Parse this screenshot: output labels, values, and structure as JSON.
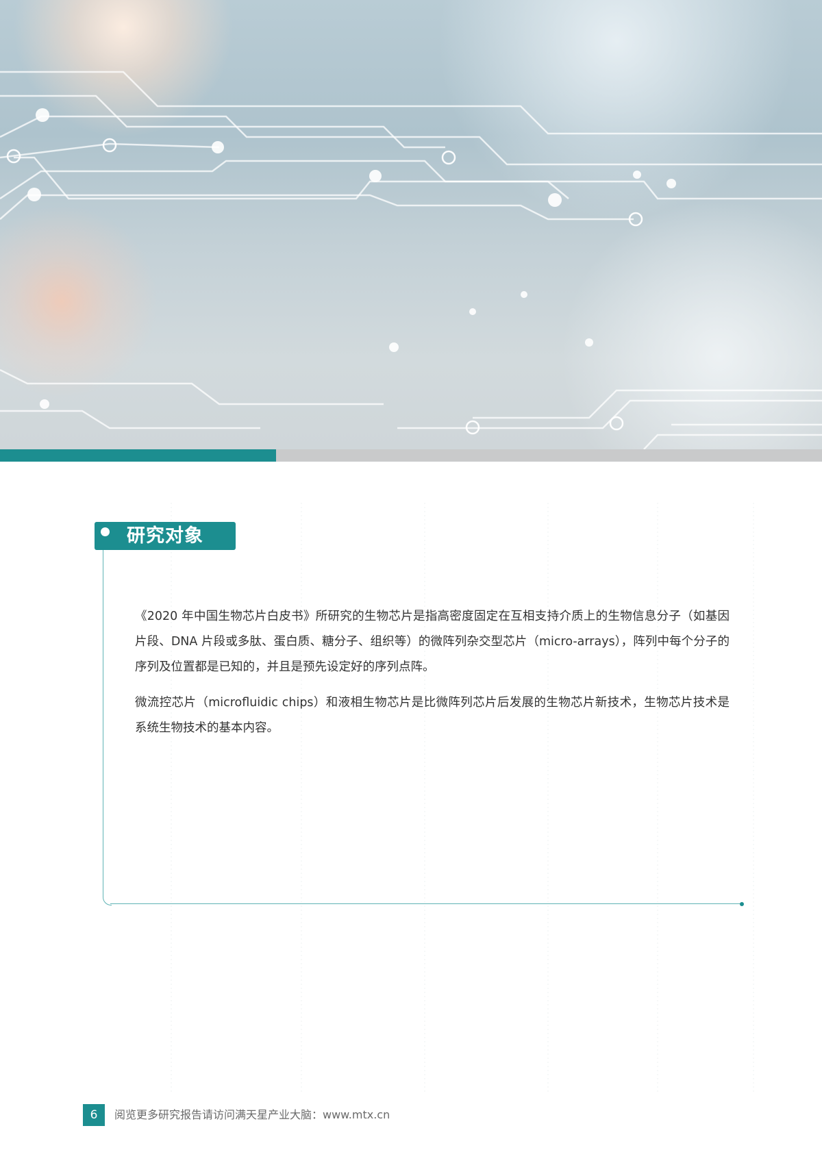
{
  "hero": {
    "image_description": "circuit-board-lines-background",
    "accent_color": "#1c8e90"
  },
  "section": {
    "title": "研究对象",
    "accent_color": "#1c8e90"
  },
  "content": {
    "paragraphs": [
      "《2020 年中国生物芯片白皮书》所研究的生物芯片是指高密度固定在互相支持介质上的生物信息分子（如基因片段、DNA 片段或多肽、蛋白质、糖分子、组织等）的微阵列杂交型芯片（micro-arrays），阵列中每个分子的序列及位置都是已知的，并且是预先设定好的序列点阵。",
      "微流控芯片（microfluidic chips）和液相生物芯片是比微阵列芯片后发展的生物芯片新技术，生物芯片技术是系统生物技术的基本内容。"
    ]
  },
  "footer": {
    "page_number": "6",
    "text": "阅览更多研究报告请访问满天星产业大脑：www.mtx.cn"
  }
}
